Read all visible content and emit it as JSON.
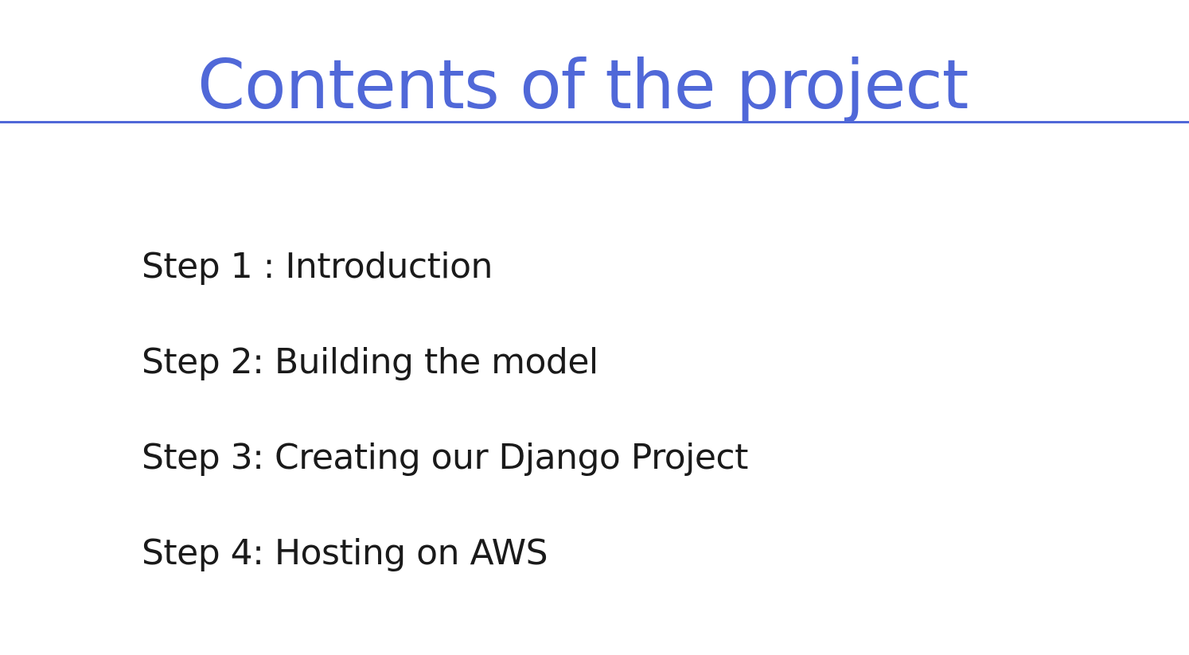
{
  "slide": {
    "title": "Contents of the project",
    "accent_color": "#5068d8",
    "steps": [
      "Step 1 : Introduction",
      "Step 2: Building the model",
      "Step 3: Creating our Django Project",
      "Step 4: Hosting on AWS"
    ]
  }
}
